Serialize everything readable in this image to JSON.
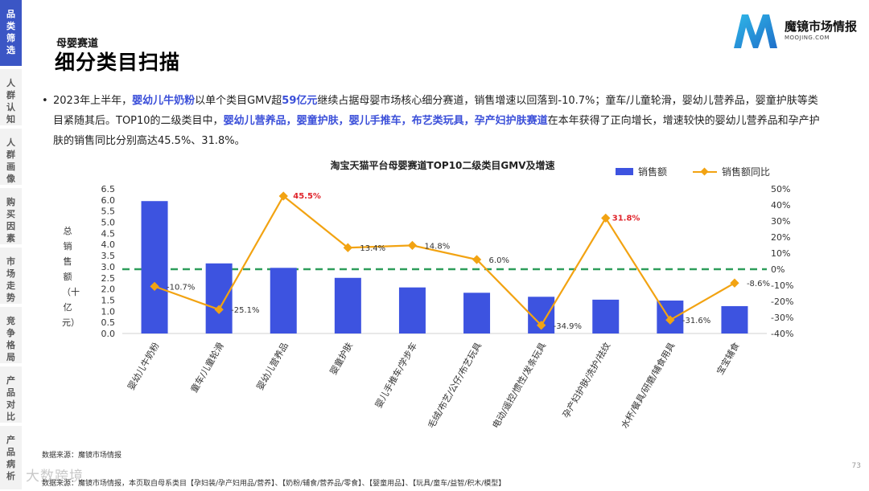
{
  "sidebar": {
    "tabs": [
      {
        "label": "品类筛选",
        "active": true
      },
      {
        "label": "人群认知",
        "active": false
      },
      {
        "label": "人群画像",
        "active": false
      },
      {
        "label": "购买因素",
        "active": false
      },
      {
        "label": "市场走势",
        "active": false
      },
      {
        "label": "竞争格局",
        "active": false
      },
      {
        "label": "产品对比",
        "active": false
      },
      {
        "label": "产品病析",
        "active": false
      }
    ]
  },
  "header": {
    "subtitle": "母婴赛道",
    "title": "细分类目扫描",
    "logo_name": "魔镜市场情报",
    "logo_sub": "MOOJING.COM"
  },
  "summary": {
    "bullet": "•",
    "segments": [
      {
        "text": "2023年上半年，",
        "hl": false
      },
      {
        "text": "婴幼儿牛奶粉",
        "hl": true
      },
      {
        "text": "以单个类目GMV超",
        "hl": false
      },
      {
        "text": "59亿元",
        "hl": true
      },
      {
        "text": "继续占据母婴市场核心细分赛道，销售增速以回落到-10.7%；童车/儿童轮滑，婴幼儿营养品，婴童护肤等类目紧随其后。TOP10的二级类目中，",
        "hl": false
      },
      {
        "text": "婴幼儿营养品，婴童护肤，婴儿手推车，布艺类玩具，孕产妇护肤赛道",
        "hl": true
      },
      {
        "text": "在本年获得了正向增长，增速较快的婴幼儿营养品和孕产护肤的销售同比分别高达45.5%、31.8%。",
        "hl": false
      }
    ]
  },
  "chart_data": {
    "type": "bar",
    "title": "淘宝天猫平台母婴赛道TOP10二级类目GMV及增速",
    "ylabel": "总销售额（十亿元）",
    "ylim": [
      0,
      6.5
    ],
    "y2lim": [
      -40,
      50
    ],
    "yticks": [
      "0.0",
      "0.5",
      "1.0",
      "1.5",
      "2.0",
      "2.5",
      "3.0",
      "3.5",
      "4.0",
      "4.5",
      "5.0",
      "5.5",
      "6.0",
      "6.5"
    ],
    "y2ticks": [
      "-40%",
      "-30%",
      "-20%",
      "-10%",
      "0%",
      "10%",
      "20%",
      "30%",
      "40%",
      "50%"
    ],
    "categories": [
      "婴幼儿牛奶粉",
      "童车/儿童轮滑",
      "婴幼儿营养品",
      "婴童护肤",
      "婴儿手推车/学步车",
      "毛绒/布艺/公仔/布艺玩具",
      "电动/遥控/惯性/发条玩具",
      "孕产妇护肤/洗护/祛纹",
      "水杯/餐具/研磨/辅食用具",
      "宝宝辅食"
    ],
    "series": [
      {
        "name": "销售额",
        "type": "bar",
        "color": "#3d53e0",
        "values": [
          5.95,
          3.15,
          2.95,
          2.5,
          2.07,
          1.83,
          1.65,
          1.52,
          1.48,
          1.23
        ]
      },
      {
        "name": "销售额同比",
        "type": "line",
        "color": "#f2a312",
        "values": [
          -10.7,
          -25.1,
          45.5,
          13.4,
          14.8,
          6.0,
          -34.9,
          31.8,
          -31.6,
          -8.6
        ],
        "labels": [
          "-10.7%",
          "-25.1%",
          "45.5%",
          "13.4%",
          "14.8%",
          "6.0%",
          "-34.9%",
          "31.8%",
          "-31.6%",
          "-8.6%"
        ],
        "label_emphasis": [
          false,
          false,
          true,
          false,
          false,
          false,
          false,
          true,
          false,
          false
        ]
      }
    ],
    "reference_line": {
      "value": 0,
      "axis": "y2",
      "style": "dashed",
      "color": "#2e9e5b"
    },
    "legend_position": "top-right",
    "grid": false
  },
  "footer": {
    "source": "数据来源：魔镜市场情报",
    "note": "数据来源：魔镜市场情报，本页取自母系类目【孕妇装/孕产妇用品/营养】、【奶粉/辅食/营养品/零食】、【婴童用品】、【玩具/童车/益智/积木/模型】",
    "watermark": "大数跨境",
    "page_number": "73"
  },
  "colors": {
    "accent": "#3b56c5",
    "bar": "#3d53e0",
    "line": "#f2a312",
    "highlight_label": "#e0242b",
    "zero_line": "#2e9e5b"
  }
}
